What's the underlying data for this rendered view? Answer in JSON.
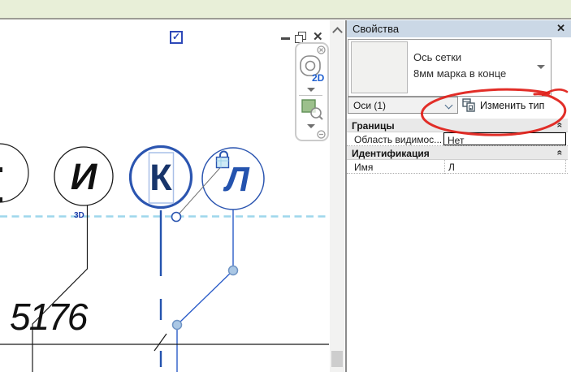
{
  "colors": {
    "selection_blue": "#2b55b0",
    "grid_cyan_dash": "#9ed7ec",
    "annotation_red": "#e0231c",
    "panel_header": "#cbd8e6",
    "ribbon_band": "#e8efd8"
  },
  "canvas": {
    "checkbox_icon": "✓",
    "grid_bubbles": [
      {
        "label": "И"
      },
      {
        "label": "К"
      },
      {
        "label": "Л"
      }
    ],
    "extent_label": "3D",
    "dimension_text": "5176"
  },
  "view_window": {
    "close_icon": "✕"
  },
  "navigation_bar": {
    "wheel_label": "2D"
  },
  "icons": {
    "collapse": "«"
  },
  "properties_panel": {
    "title": "Свойства",
    "close_icon": "✕",
    "type_selector": {
      "family": "Ось сетки",
      "type_name": "8мм марка в конце"
    },
    "selection_filter": "Оси (1)",
    "edit_type_label": "Изменить тип",
    "sections": [
      {
        "title": "Границы",
        "rows": [
          {
            "label": "Область видимос...",
            "value": "Нет"
          }
        ]
      },
      {
        "title": "Идентификация",
        "rows": [
          {
            "label": "Имя",
            "value": "Л"
          }
        ]
      }
    ]
  }
}
